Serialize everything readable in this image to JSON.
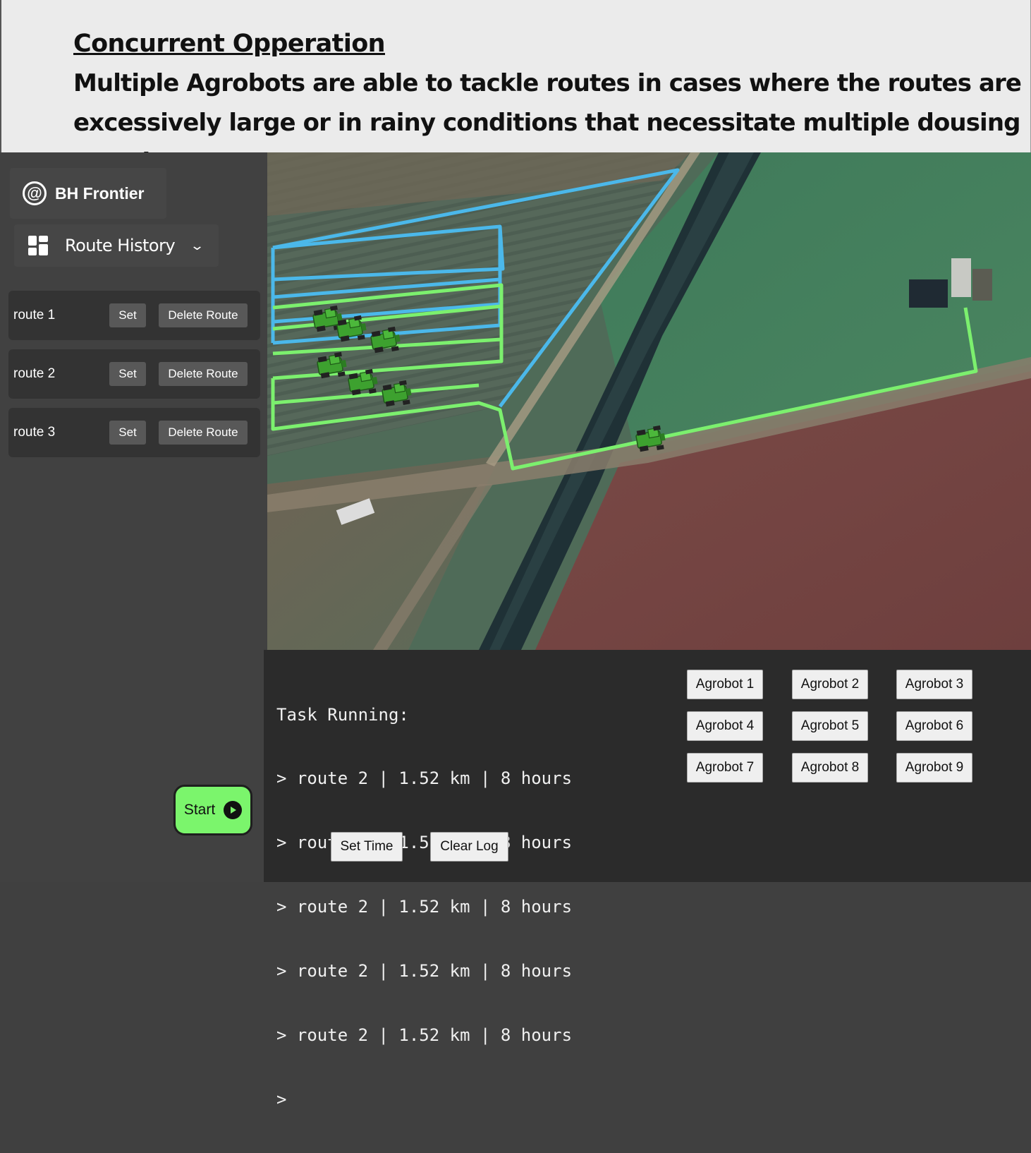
{
  "caption": {
    "title": "Concurrent Opperation",
    "body": "Multiple Agrobots are able to tackle routes in cases where the routes are excessively large or in rainy conditions that necessitate multiple dousing rounds"
  },
  "sidebar": {
    "brand_icon": "@",
    "brand_name": "BH Frontier",
    "nav_label": "Route History",
    "nav_icon": "grid-icon",
    "routes": [
      {
        "name": "route 1",
        "set_label": "Set",
        "delete_label": "Delete Route"
      },
      {
        "name": "route 2",
        "set_label": "Set",
        "delete_label": "Delete Route"
      },
      {
        "name": "route 3",
        "set_label": "Set",
        "delete_label": "Delete Route"
      }
    ],
    "start_label": "Start"
  },
  "map": {
    "route_colors": {
      "blue": "#4bb8ea",
      "green": "#7cf06e"
    },
    "agrobot_count": 7
  },
  "console": {
    "log_lines": [
      "Task Running:",
      "> route 2 | 1.52 km | 8 hours",
      "> route 2 | 1.52 km | 8 hours",
      "> route 2 | 1.52 km | 8 hours",
      "> route 2 | 1.52 km | 8 hours",
      "> route 2 | 1.52 km | 8 hours",
      ">"
    ],
    "set_time_label": "Set Time",
    "clear_log_label": "Clear Log",
    "agrobots": [
      "Agrobot 1",
      "Agrobot 2",
      "Agrobot 3",
      "Agrobot 4",
      "Agrobot 5",
      "Agrobot 6",
      "Agrobot 7",
      "Agrobot 8",
      "Agrobot 9"
    ]
  }
}
